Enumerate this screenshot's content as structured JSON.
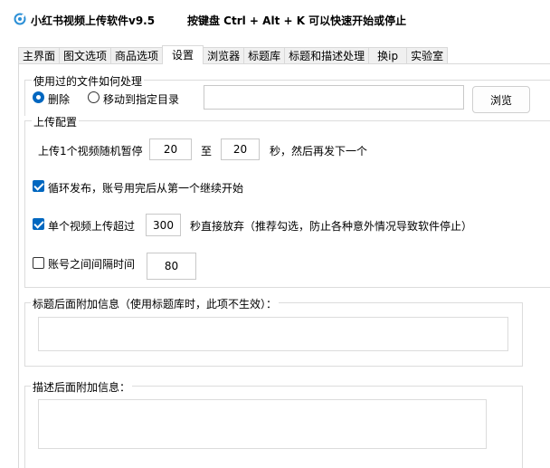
{
  "app": {
    "title": "小红书视频上传软件v9.5",
    "hotkey_hint": "按键盘 Ctrl + Alt + K  可以快速开始或停止",
    "accent_color": "#0067c0"
  },
  "tabs": [
    {
      "label": "主界面"
    },
    {
      "label": "图文选项"
    },
    {
      "label": "商品选项"
    },
    {
      "label": "设置"
    },
    {
      "label": "浏览器"
    },
    {
      "label": "标题库"
    },
    {
      "label": "标题和描述处理"
    },
    {
      "label": "换ip"
    },
    {
      "label": "实验室"
    }
  ],
  "active_tab": "设置",
  "file_handling": {
    "group_label": "使用过的文件如何处理",
    "option_delete": "删除",
    "option_move": "移动到指定目录",
    "selected": "删除",
    "directory_value": "",
    "browse_label": "浏览"
  },
  "upload_config": {
    "group_label": "上传配置",
    "pause_prefix": "上传1个视频随机暂停",
    "pause_min": "20",
    "pause_to": "至",
    "pause_max": "20",
    "pause_suffix": "秒，然后再发下一个",
    "loop_label": "循环发布，账号用完后从第一个继续开始",
    "loop_checked": true,
    "timeout_label": "单个视频上传超过",
    "timeout_checked": true,
    "timeout_value": "300",
    "timeout_suffix": "秒直接放弃（推荐勾选，防止各种意外情况导致软件停止）",
    "interval_label": "账号之间间隔时间",
    "interval_checked": false,
    "interval_value": "80"
  },
  "title_suffix": {
    "group_label": "标题后面附加信息（使用标题库时，此项不生效）：",
    "value": ""
  },
  "desc_suffix": {
    "group_label": "描述后面附加信息：",
    "value": ""
  }
}
